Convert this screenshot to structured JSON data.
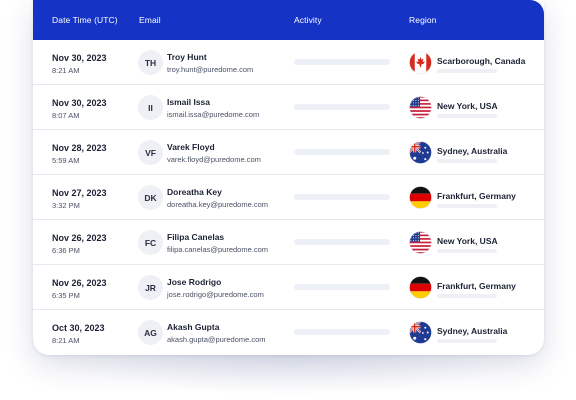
{
  "header": {
    "date_col": "Date Time (UTC)",
    "email_col": "Email",
    "activity_col": "Activity",
    "region_col": "Region"
  },
  "rows": [
    {
      "date": "Nov 30, 2023",
      "time": "8:21 AM",
      "initials": "TH",
      "name": "Troy Hunt",
      "email": "troy.hunt@puredome.com",
      "region": "Scarborough, Canada",
      "flag": "canada-flag-icon"
    },
    {
      "date": "Nov 30, 2023",
      "time": "8:07 AM",
      "initials": "II",
      "name": "Ismail Issa",
      "email": "ismail.issa@puredome.com",
      "region": "New York, USA",
      "flag": "usa-flag-icon"
    },
    {
      "date": "Nov 28, 2023",
      "time": "5:59 AM",
      "initials": "VF",
      "name": "Varek Floyd",
      "email": "varek.floyd@puredome.com",
      "region": "Sydney, Australia",
      "flag": "australia-flag-icon"
    },
    {
      "date": "Nov 27, 2023",
      "time": "3:32 PM",
      "initials": "DK",
      "name": "Doreatha Key",
      "email": "doreatha.key@puredome.com",
      "region": "Frankfurt, Germany",
      "flag": "germany-flag-icon"
    },
    {
      "date": "Nov 26, 2023",
      "time": "6:36 PM",
      "initials": "FC",
      "name": "Filipa Canelas",
      "email": "filipa.canelas@puredome.com",
      "region": "New York, USA",
      "flag": "usa-flag-icon"
    },
    {
      "date": "Nov 26, 2023",
      "time": "6:35 PM",
      "initials": "JR",
      "name": "Jose Rodrigo",
      "email": "jose.rodrigo@puredome.com",
      "region": "Frankfurt, Germany",
      "flag": "germany-flag-icon"
    },
    {
      "date": "Oct 30, 2023",
      "time": "8:21 AM",
      "initials": "AG",
      "name": "Akash Gupta",
      "email": "akash.gupta@puredome.com",
      "region": "Sydney, Australia",
      "flag": "australia-flag-icon"
    }
  ],
  "colors": {
    "header_bg": "#1534c6",
    "row_divider": "#e7e9f1",
    "placeholder_bar": "#edf0f7"
  }
}
